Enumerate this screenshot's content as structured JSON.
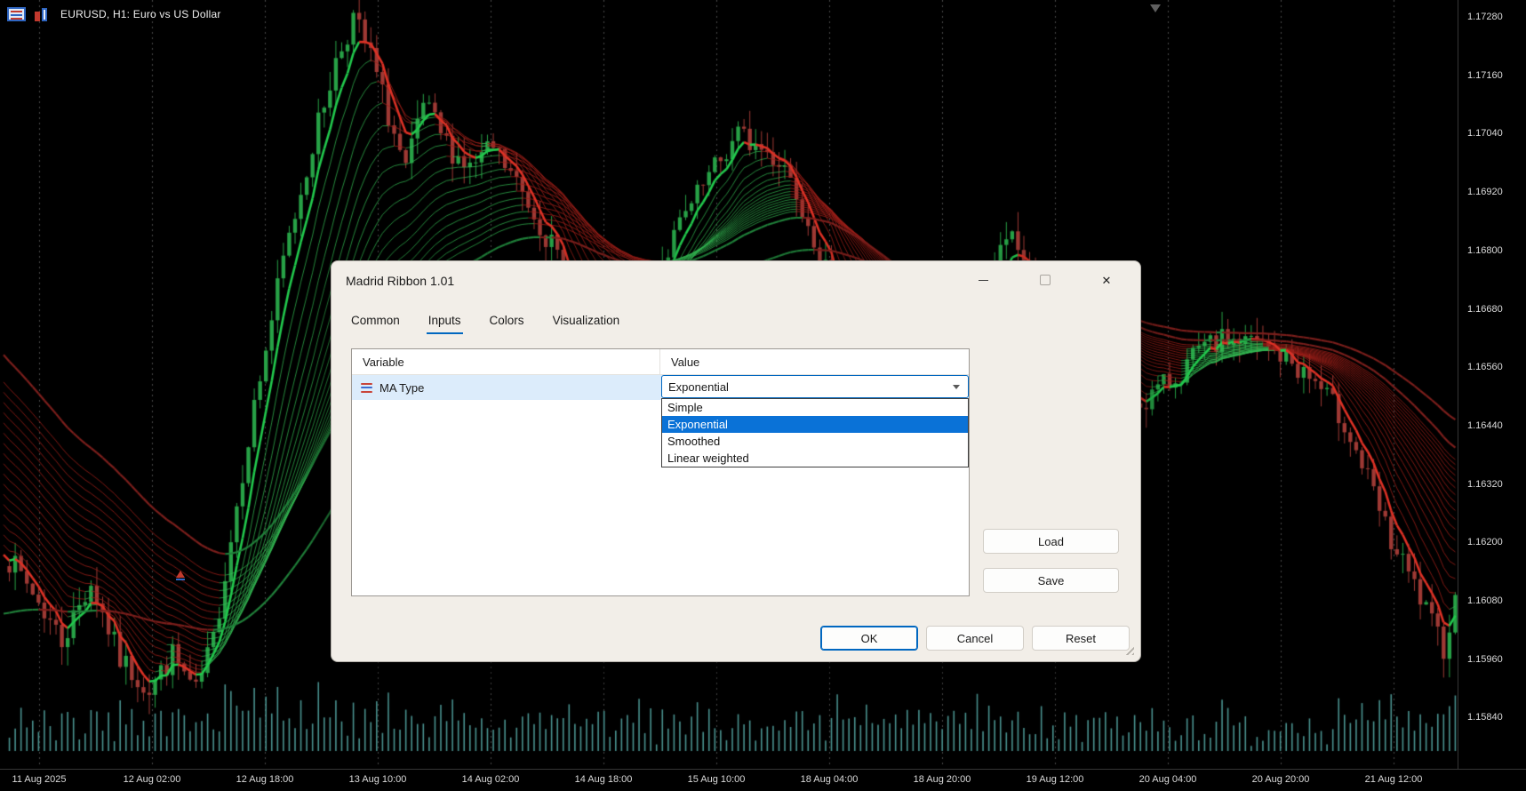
{
  "chart": {
    "title": "EURUSD, H1:  Euro vs US Dollar",
    "price_labels": [
      "1.17280",
      "1.17160",
      "1.17040",
      "1.16920",
      "1.16800",
      "1.16680",
      "1.16560",
      "1.16440",
      "1.16320",
      "1.16200",
      "1.16080",
      "1.15960",
      "1.15840"
    ],
    "time_labels": [
      "11 Aug 2025",
      "12 Aug 02:00",
      "12 Aug 18:00",
      "13 Aug 10:00",
      "14 Aug 02:00",
      "14 Aug 18:00",
      "15 Aug 10:00",
      "18 Aug 04:00",
      "18 Aug 20:00",
      "19 Aug 12:00",
      "20 Aug 04:00",
      "20 Aug 20:00",
      "21 Aug 12:00"
    ],
    "colors": {
      "background": "#000000",
      "grid": "#4a4a4a",
      "up_candle": "#27a146",
      "down_candle": "#9e3934",
      "ribbon_bull_fast": "#22c94d",
      "ribbon_bear_fast": "#de3125",
      "ribbon_bull_thin": "rgba(52,190,84,0.72)",
      "ribbon_bear_thin": "rgba(156,30,25,0.82)",
      "ribbon_bull_slow": "#20803a",
      "ribbon_bear_slow": "#7c1f1c",
      "volume": "#4a9390"
    }
  },
  "dialog": {
    "title": "Madrid Ribbon 1.01",
    "icons": {
      "close": "✕"
    },
    "tabs": [
      "Common",
      "Inputs",
      "Colors",
      "Visualization"
    ],
    "active_tab": "Inputs",
    "table": {
      "headers": [
        "Variable",
        "Value"
      ],
      "rows": [
        {
          "variable": "MA Type",
          "value": "Exponential"
        }
      ]
    },
    "dropdown": {
      "value": "Exponential",
      "options": [
        "Simple",
        "Exponential",
        "Smoothed",
        "Linear weighted"
      ],
      "selected_index": 1
    },
    "buttons": {
      "load": "Load",
      "save": "Save",
      "ok": "OK",
      "cancel": "Cancel",
      "reset": "Reset"
    }
  }
}
